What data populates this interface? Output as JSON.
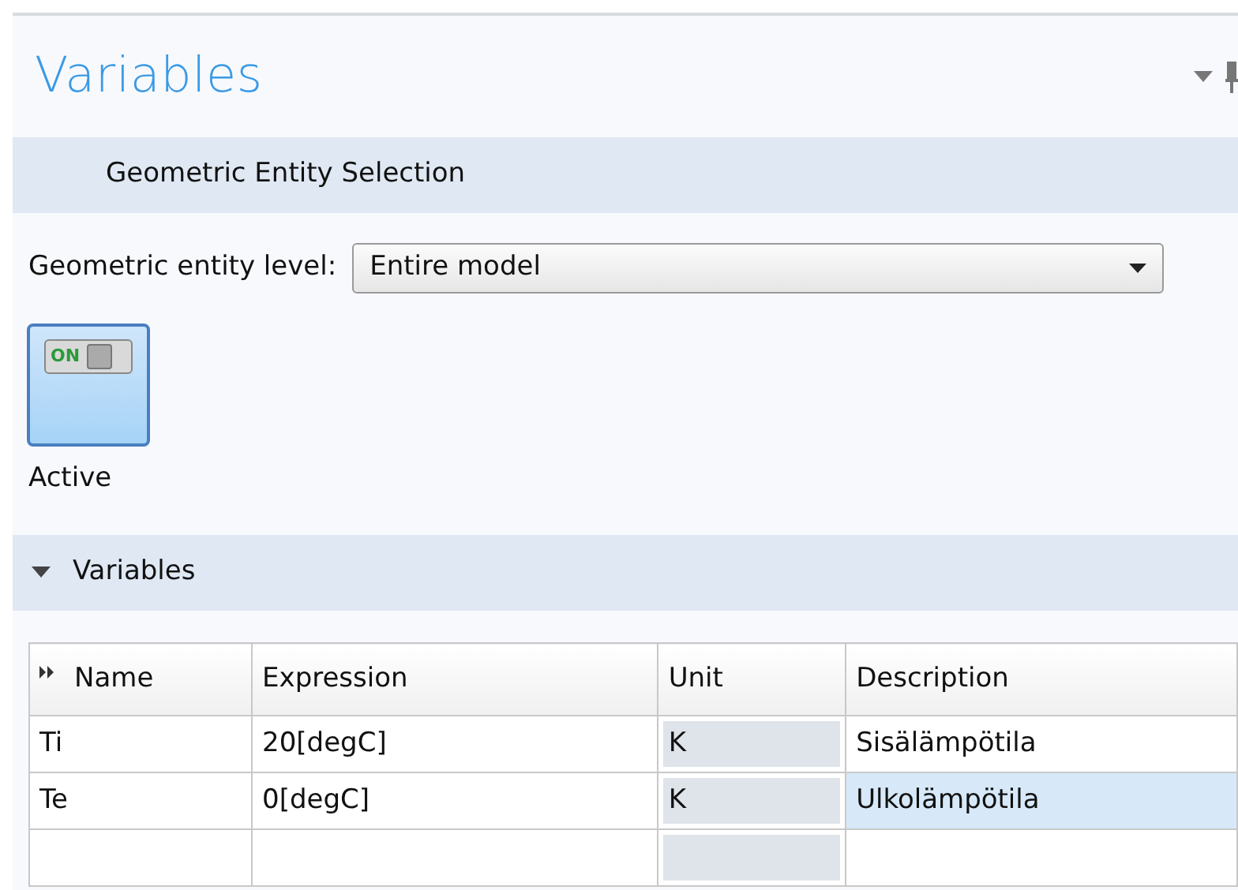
{
  "title": "Variables",
  "selection_section": {
    "title": "Geometric Entity Selection",
    "level_label": "Geometric entity level:",
    "level_value": "Entire model"
  },
  "active_toggle": {
    "switch_text": "ON",
    "on": true,
    "label": "Active"
  },
  "variables_section": {
    "title": "Variables",
    "expanded": true
  },
  "table": {
    "columns": [
      "Name",
      "Expression",
      "Unit",
      "Description"
    ],
    "rows": [
      {
        "name": "Ti",
        "expression": "20[degC]",
        "unit": "K",
        "description": "Sisälämpötila",
        "selected": false
      },
      {
        "name": "Te",
        "expression": "0[degC]",
        "unit": "K",
        "description": "Ulkolämpötila",
        "selected": true
      }
    ]
  }
}
